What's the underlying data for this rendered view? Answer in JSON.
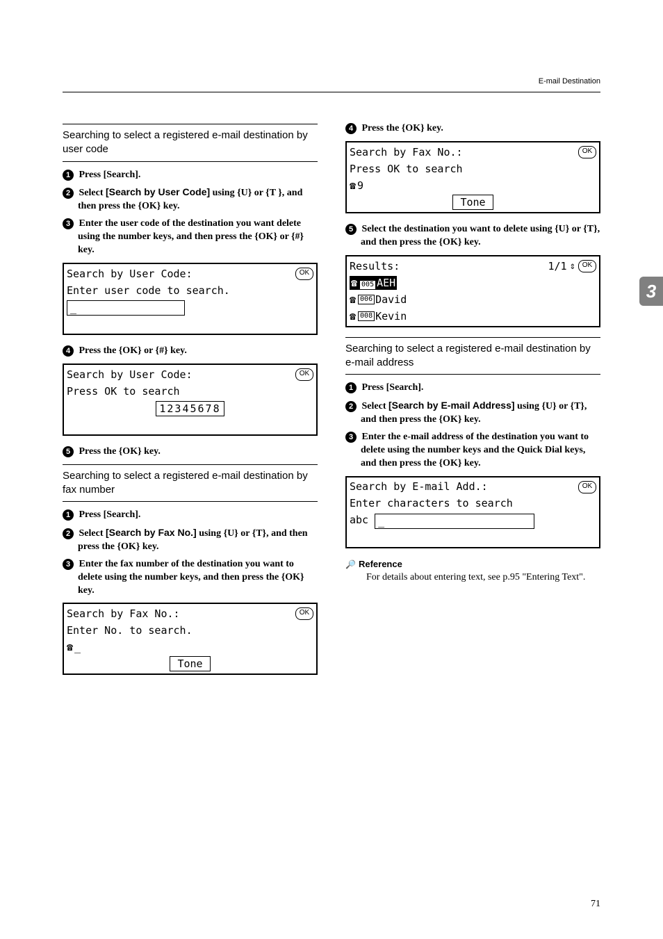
{
  "header": {
    "running": "E-mail Destination"
  },
  "tab": "3",
  "pagenum": "71",
  "left": {
    "sec1": {
      "title": "Searching to select a registered e-mail destination by user code",
      "s1": "Press [Search].",
      "s2a": "Select ",
      "s2b": "[Search by User Code]",
      "s2c": " using {U} or {T }, and then press the {OK} key.",
      "s3": "Enter the user code of the destination you want delete using the number keys, and then press the {OK} or {#} key.",
      "lcd1": {
        "l1": "Search by User Code:",
        "ok": "OK",
        "l2": "Enter user code to search.",
        "input": "_"
      },
      "s4": "Press the {OK} or {#} key.",
      "lcd2": {
        "l1": "Search by User Code:",
        "ok": "OK",
        "l2": "Press OK to search",
        "input": "12345678"
      },
      "s5": "Press the {OK} key."
    },
    "sec2": {
      "title": "Searching to select a registered e-mail destination by fax number",
      "s1": "Press [Search].",
      "s2a": "Select ",
      "s2b": "[Search by Fax No.]",
      "s2c": " using {U} or {T}, and then press the {OK} key.",
      "s3": "Enter the fax number of the destination you want to delete using the number keys, and then press the {OK} key.",
      "lcd": {
        "l1": "Search by Fax No.:",
        "ok": "OK",
        "l2": "Enter No. to search.",
        "input": "_",
        "tone": "Tone"
      }
    }
  },
  "right": {
    "s4": "Press the {OK} key.",
    "lcd1": {
      "l1": "Search by Fax No.:",
      "ok": "OK",
      "l2": "Press OK to search",
      "input": "9",
      "tone": "Tone"
    },
    "s5": "Select the destination you want to delete using {U} or {T}, and then press the {OK} key.",
    "lcd2": {
      "l1": "Results:",
      "count": "1/1",
      "ok": "OK",
      "r1c": "005",
      "r1t": "AEH",
      "r2c": "006",
      "r2t": "David",
      "r3c": "008",
      "r3t": "Kevin"
    },
    "sec3": {
      "title": "Searching to select a registered e-mail destination by e-mail address",
      "s1": "Press [Search].",
      "s2a": "Select ",
      "s2b": "[Search by E-mail Address]",
      "s2c": " using {U} or {T}, and then press the {OK} key.",
      "s3": "Enter the e-mail address of the destination you want to delete using the number keys and the Quick Dial keys, and then press the {OK} key.",
      "lcd": {
        "l1": "Search by E-mail Add.:",
        "ok": "OK",
        "l2": "Enter characters to search",
        "mode": "abc",
        "input": "_"
      }
    },
    "reference": {
      "label": "Reference",
      "text": "For details about entering text, see p.95 \"Entering Text\"."
    }
  }
}
